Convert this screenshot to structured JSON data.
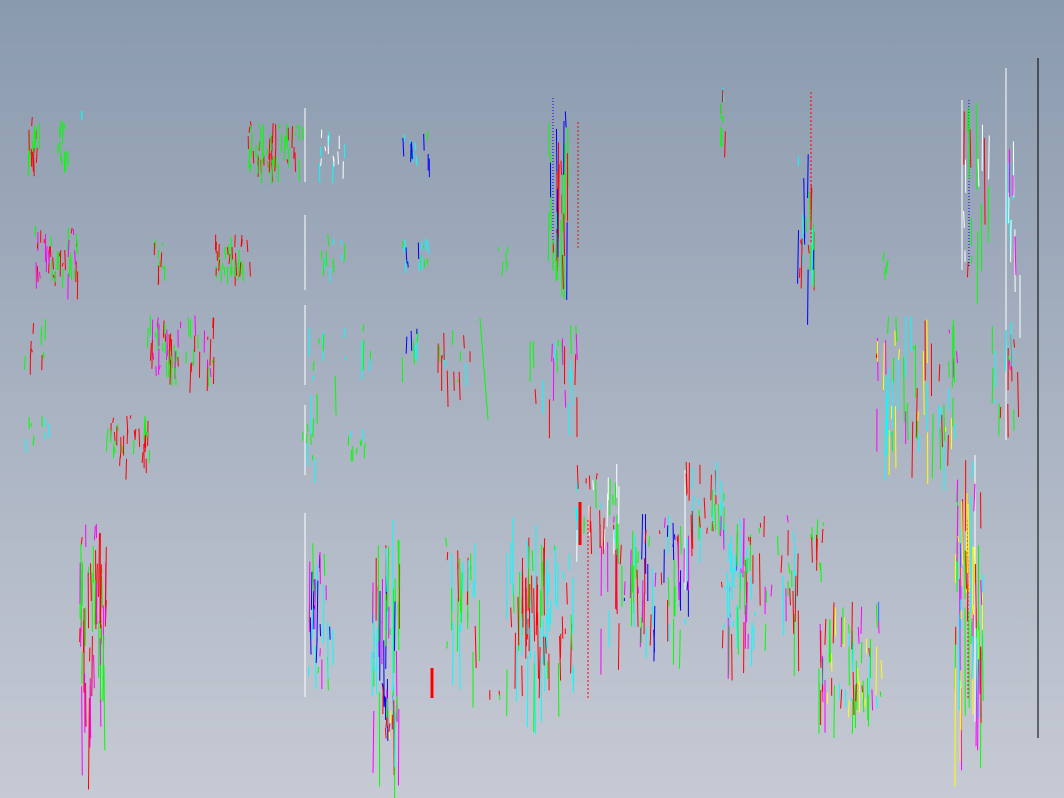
{
  "viewport": {
    "background_top": "#8a9aae",
    "background_bottom": "#c6cad4"
  },
  "palette": {
    "green": "#00ff00",
    "red": "#ff0000",
    "cyan": "#00ffff",
    "blue": "#0000ff",
    "magenta": "#ff00ff",
    "yellow": "#ffff00",
    "white": "#ffffff",
    "black": "#000000"
  },
  "drawing": {
    "kind": "cad-line-fragments",
    "has_text": false
  }
}
